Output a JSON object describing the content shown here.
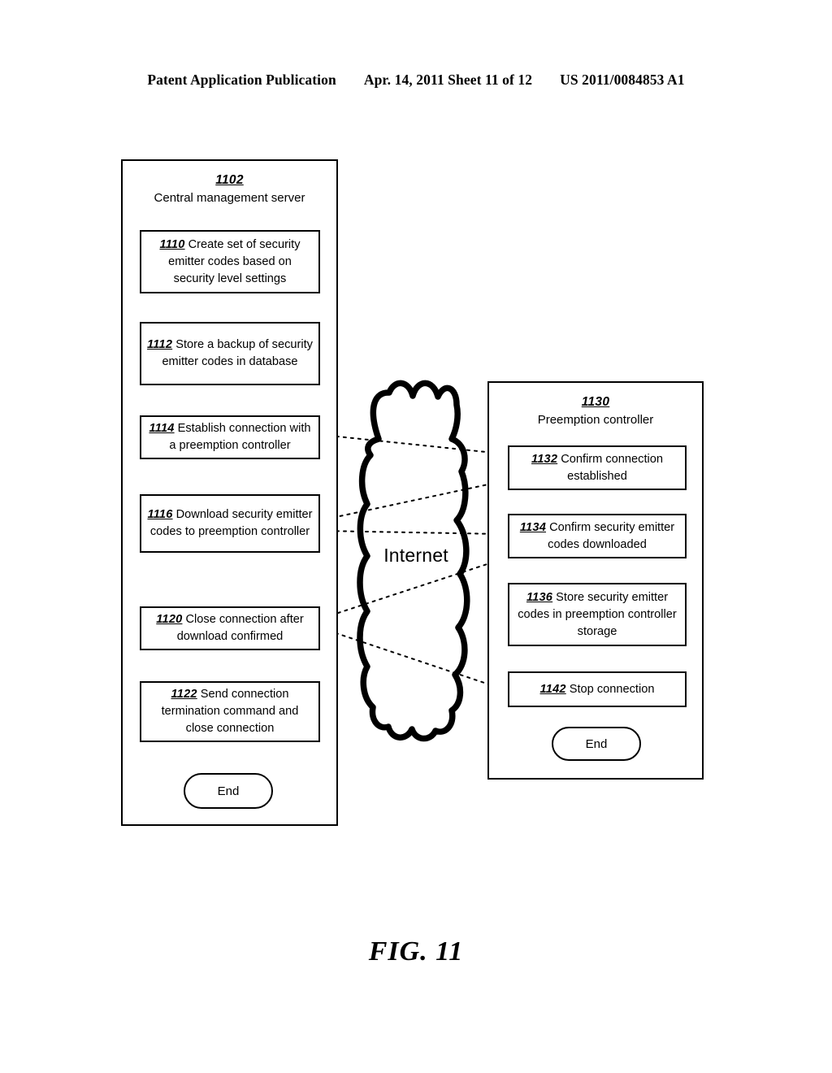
{
  "header": {
    "publication": "Patent Application Publication",
    "date_sheet": "Apr. 14, 2011  Sheet 11 of 12",
    "patent_number": "US 2011/0084853 A1"
  },
  "figure": {
    "caption": "FIG. 11"
  },
  "cloud": {
    "label": "Internet"
  },
  "lanes": [
    {
      "id": "1102",
      "number": "1102",
      "title": "Central management server"
    },
    {
      "id": "1130",
      "number": "1130",
      "title": "Preemption controller"
    }
  ],
  "left_lane_steps": [
    {
      "number": "1110",
      "text": " Create set of security emitter codes based on security level settings"
    },
    {
      "number": "1112",
      "text": " Store a backup of security emitter codes in database"
    },
    {
      "number": "1114",
      "text": " Establish connection with a preemption controller"
    },
    {
      "number": "1116",
      "text": "  Download security emitter codes to preemption controller"
    },
    {
      "number": "1120",
      "text": "  Close connection after download confirmed"
    },
    {
      "number": "1122",
      "text": "  Send connection termination command and close connection"
    }
  ],
  "right_lane_steps": [
    {
      "number": "1132",
      "text": " Confirm connection established"
    },
    {
      "number": "1134",
      "text": " Confirm security emitter codes downloaded"
    },
    {
      "number": "1136",
      "text": " Store security emitter codes in preemption controller storage"
    },
    {
      "number": "1142",
      "text": "  Stop connection"
    }
  ],
  "terminators": {
    "left_end": "End",
    "right_end": "End"
  },
  "colors": {
    "stroke": "#000000",
    "background": "#ffffff"
  }
}
